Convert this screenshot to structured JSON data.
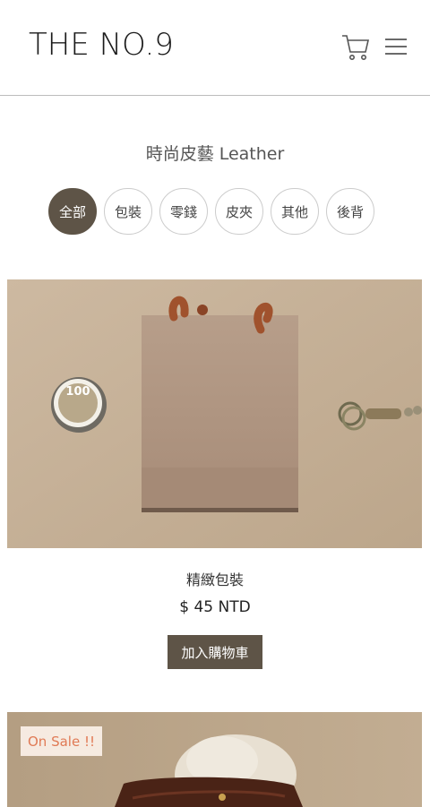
{
  "header": {
    "logo": "THE NO.9",
    "cart_icon": "shopping-cart-icon",
    "menu_icon": "hamburger-menu-icon"
  },
  "category": {
    "title": "時尚皮藝 Leather",
    "filters": [
      "全部",
      "包裝",
      "零錢",
      "皮夾",
      "其他",
      "後背"
    ],
    "active_filter": "全部"
  },
  "products": [
    {
      "name": "精緻包裝",
      "price": "$ 45 NTD",
      "add_to_cart": "加入購物車"
    },
    {
      "badge": "On Sale !!"
    }
  ],
  "colors": {
    "accent": "#5e5447",
    "sale": "#e07a55",
    "divider": "#bdbdbd"
  }
}
